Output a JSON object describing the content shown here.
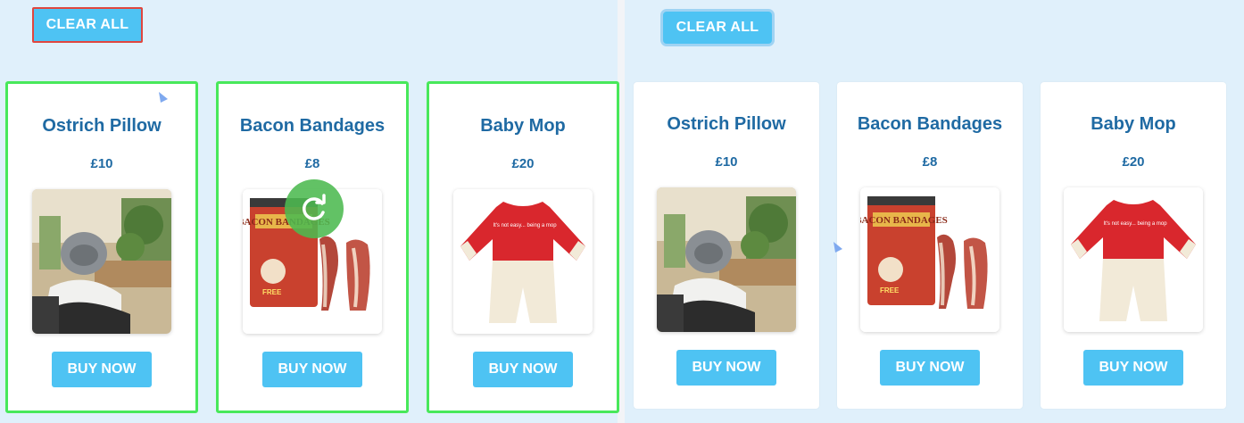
{
  "left_panel": {
    "clear_label": "CLEAR ALL",
    "products": [
      {
        "name": "Ostrich Pillow",
        "price": "£10",
        "buy_label": "BUY NOW"
      },
      {
        "name": "Bacon Bandages",
        "price": "£8",
        "buy_label": "BUY NOW"
      },
      {
        "name": "Baby Mop",
        "price": "£20",
        "buy_label": "BUY NOW"
      }
    ]
  },
  "right_panel": {
    "clear_label": "CLEAR ALL",
    "products": [
      {
        "name": "Ostrich Pillow",
        "price": "£10",
        "buy_label": "BUY NOW"
      },
      {
        "name": "Bacon Bandages",
        "price": "£8",
        "buy_label": "BUY NOW"
      },
      {
        "name": "Baby Mop",
        "price": "£20",
        "buy_label": "BUY NOW"
      }
    ]
  },
  "product_images": {
    "bacon_tin_text": "BACON BANDAGES",
    "bacon_tin_free": "FREE",
    "onesie_text": "It's not easy... being a mop"
  },
  "icons": [
    "cursor-pointer-icon",
    "reload-icon"
  ],
  "colors": {
    "accent_button": "#4ec3f3",
    "title_text": "#1f6aa3",
    "selection_outline": "#48e85a",
    "focus_outline": "#e0463f",
    "panel_bg": "#e0f0fb",
    "reload_badge": "#4cba50"
  }
}
